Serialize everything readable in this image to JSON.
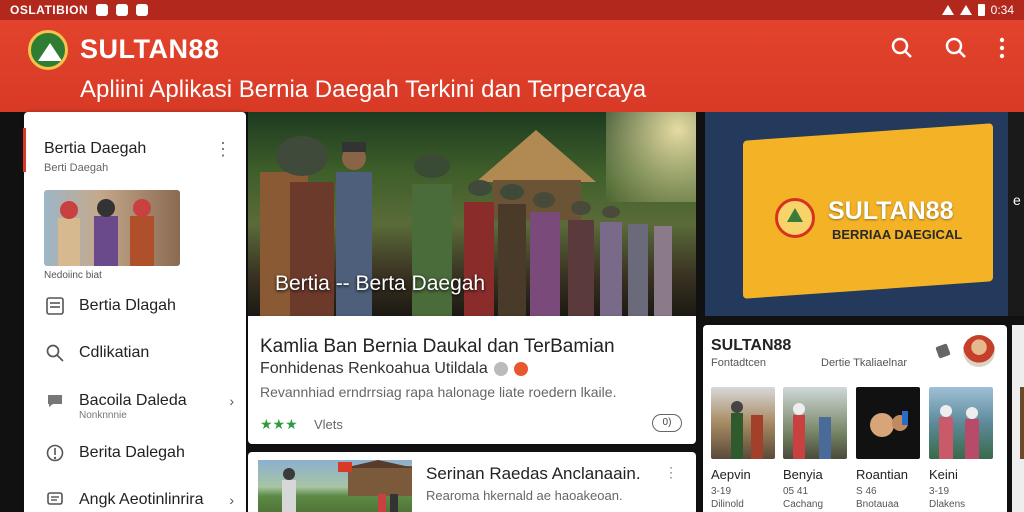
{
  "status_bar": {
    "left_text": "OSLATIBION",
    "time": "0:34"
  },
  "app_bar": {
    "title": "SULTAN88",
    "subtitle": "Apliini  Aplikasi Bernia Daegah Terkini dan Terpercaya",
    "icons": [
      "search-icon",
      "search-icon",
      "more-vert-icon"
    ]
  },
  "drawer": {
    "title": "Bertia Daegah",
    "subtitle": "Berti Daegah",
    "caption": "Nedoiinc biat",
    "items": [
      {
        "label": "Bertia Dlagah",
        "icon": "list-icon"
      },
      {
        "label": "Cdlikatian",
        "icon": "search-icon"
      },
      {
        "label": "Bacoila Daleda",
        "sub": "Nonknnnie",
        "icon": "chat-icon",
        "chevron": true
      },
      {
        "label": "Berita Dalegah",
        "icon": "pin-icon"
      },
      {
        "label": "Angk Aeotinlinrira",
        "icon": "comment-icon",
        "chevron": true
      }
    ]
  },
  "hero": {
    "caption": "Bertia -- Berta Daegah"
  },
  "banner": {
    "title": "SULTAN88",
    "subtitle": "BERRIAA DAEGICAL",
    "edge_char": "e"
  },
  "article_main": {
    "headline": "Kamlia Ban Bernia Daukal dan TerBamian",
    "subline": "Fonhidenas Renkoahua Utildala",
    "description": "Revannhiad erndrrsiag rapa halonage liate roedern lkaile.",
    "stars": "★★★",
    "views": "Vlets",
    "pill": "0)"
  },
  "article_second": {
    "headline": "Serinan Raedas Anclanaain.",
    "description": "Rearoma hkernald ae haoakeoan."
  },
  "sidebar_list": {
    "title": "SULTAN88",
    "subtitle_left": "Fontadtcen",
    "subtitle_right": "Dertie Tkaliaelnar",
    "tiles": [
      {
        "label": "Aepvin",
        "meta1": "3-19",
        "meta2": "Dilinold"
      },
      {
        "label": "Benyia",
        "meta1": "05 41",
        "meta2": "Cachang"
      },
      {
        "label": "Roantian",
        "meta1": "S 46",
        "meta2": "Bnotauaa"
      },
      {
        "label": "Keini",
        "meta1": "3-19",
        "meta2": "Dlakens"
      }
    ]
  },
  "colors": {
    "brand": "#d83a26",
    "status": "#b2281c",
    "star": "#2e9c3e",
    "accent_yellow": "#f4b326"
  }
}
